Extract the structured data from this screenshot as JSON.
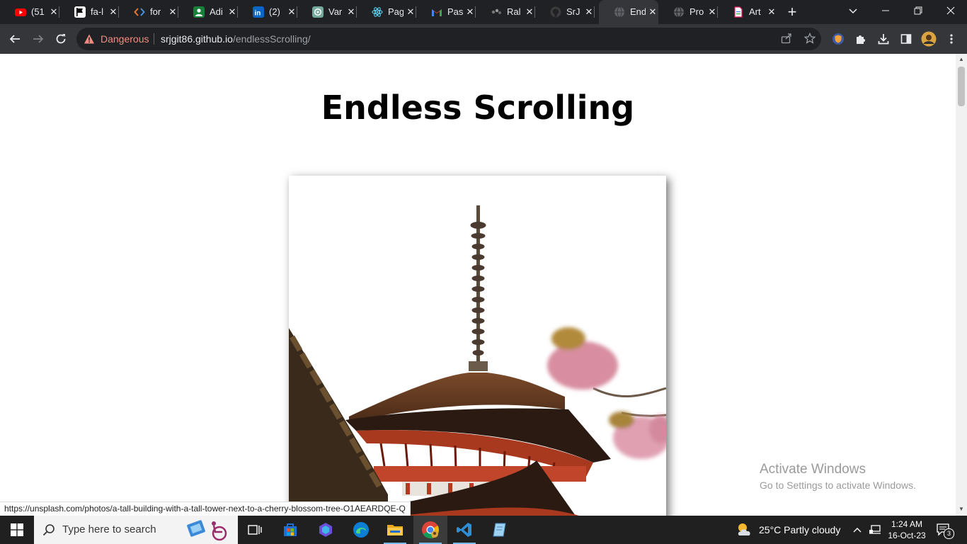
{
  "browser": {
    "tabs": [
      {
        "title": "(51",
        "icon": "youtube-icon"
      },
      {
        "title": "fa-l",
        "icon": "flag-icon"
      },
      {
        "title": "for",
        "icon": "code-icon"
      },
      {
        "title": "Adi",
        "icon": "person-badge-icon"
      },
      {
        "title": "(2)",
        "icon": "linkedin-icon"
      },
      {
        "title": "Var",
        "icon": "chatgpt-icon"
      },
      {
        "title": "Pag",
        "icon": "react-icon"
      },
      {
        "title": "Pas",
        "icon": "gmail-icon"
      },
      {
        "title": "Ral",
        "icon": "dots-logo-icon"
      },
      {
        "title": "SrJ",
        "icon": "github-icon"
      },
      {
        "title": "End",
        "icon": "globe-icon"
      },
      {
        "title": "Pro",
        "icon": "globe-icon"
      },
      {
        "title": "Art",
        "icon": "document-icon"
      }
    ],
    "active_tab_index": 10,
    "security_label": "Dangerous",
    "url_host": "srjgit86.github.io",
    "url_path": "/endlessScrolling/",
    "status_url": "https://unsplash.com/photos/a-tall-building-with-a-tall-tower-next-to-a-cherry-blossom-tree-O1AEARDQE-Q",
    "colors": {
      "tabstrip": "#202124",
      "toolbar": "#35363a",
      "danger": "#f28b82"
    }
  },
  "page": {
    "title": "Endless Scrolling",
    "image_subject": "pagoda-with-cherry-blossom"
  },
  "watermark": {
    "title": "Activate Windows",
    "subtitle": "Go to Settings to activate Windows."
  },
  "taskbar": {
    "search_placeholder": "Type here to search",
    "weather": "25°C  Partly cloudy",
    "time": "1:24 AM",
    "date": "16-Oct-23",
    "notification_count": "3",
    "apps": [
      "task-view-icon",
      "microsoft-store-icon",
      "copilot-icon",
      "edge-icon",
      "file-explorer-icon",
      "chrome-icon",
      "vscode-icon",
      "notepad-icon"
    ]
  }
}
